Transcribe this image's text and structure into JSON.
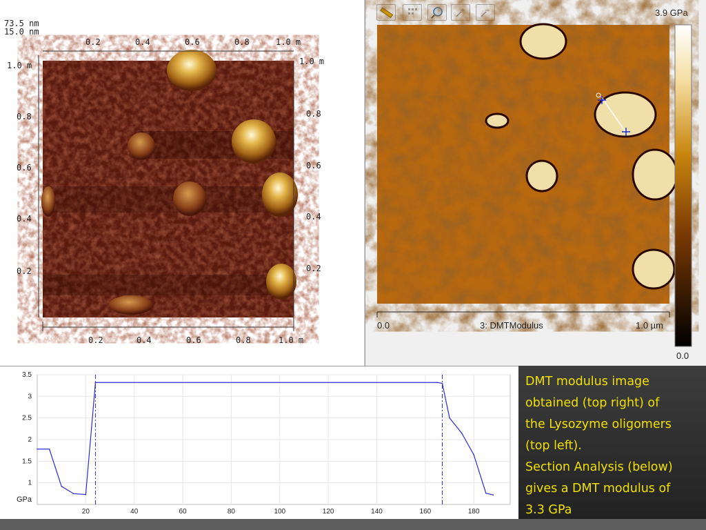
{
  "afm3d": {
    "z_scale_top": "73.5 nm",
    "z_scale_bottom": "15.0 nm",
    "top_ticks": [
      "0.2",
      "0.4",
      "0.6",
      "0.8",
      "1.0 m"
    ],
    "left_top_label": "1.0 m",
    "left_ticks": [
      "0.8",
      "0.6",
      "0.4",
      "0.2"
    ],
    "right_top_label": "1.0 m",
    "right_ticks": [
      "0.8",
      "0.6",
      "0.4",
      "0.2"
    ],
    "bottom_ticks": [
      "0.2",
      "0.4",
      "0.6",
      "0.8",
      "1.0 m"
    ]
  },
  "dmt": {
    "tools": [
      "ruler-icon",
      "grid-select-icon",
      "zoom-icon",
      "zoom-in-icon",
      "zoom-out-icon"
    ],
    "scale_max": "3.9 GPa",
    "scale_min": "0.0",
    "axis_start": "0.0",
    "channel_label": "3: DMTModulus",
    "axis_end": "1.0 µm"
  },
  "section_chart": {
    "y_unit": "GPa",
    "y_ticks": [
      "3.5",
      "3",
      "2.5",
      "2",
      "1.5",
      "1"
    ],
    "x_ticks": [
      "20",
      "40",
      "60",
      "80",
      "100",
      "120",
      "140",
      "160",
      "180"
    ],
    "line_color": "#2b2bd8"
  },
  "chart_data": {
    "type": "line",
    "xlabel": "",
    "ylabel": "GPa",
    "xlim": [
      0,
      195
    ],
    "ylim": [
      0.5,
      3.5
    ],
    "x": [
      0,
      5,
      10,
      15,
      20,
      24,
      165,
      167,
      170,
      175,
      180,
      185,
      188
    ],
    "y": [
      1.78,
      1.78,
      0.92,
      0.75,
      0.73,
      3.32,
      3.32,
      3.3,
      2.5,
      2.15,
      1.65,
      0.76,
      0.72
    ],
    "markers_x": [
      24,
      167
    ]
  },
  "caption": {
    "line1": "DMT modulus image",
    "line2": "obtained (top right) of",
    "line3": "the Lysozyme oligomers",
    "line4": "(top left).",
    "line5": "Section Analysis (below)",
    "line6": "gives a DMT modulus of",
    "line7": "3.3 GPa"
  }
}
